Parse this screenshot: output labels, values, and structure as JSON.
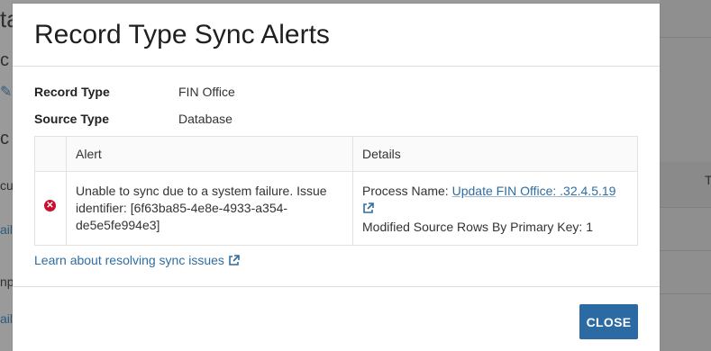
{
  "background": {
    "frag_1": "ta",
    "frag_2": "c S",
    "frag_3": "c I",
    "frag_4": "cu",
    "frag_5": "ail",
    "frag_6": "np",
    "frag_7": "ail",
    "frag_right": "T"
  },
  "modal": {
    "title": "Record Type Sync Alerts",
    "record_type_label": "Record Type",
    "record_type_value": "FIN Office",
    "source_type_label": "Source Type",
    "source_type_value": "Database",
    "table": {
      "headers": [
        "",
        "Alert",
        "Details"
      ],
      "rows": [
        {
          "status_icon": "error-circle-icon",
          "alert": "Unable to sync due to a system failure. Issue identifier: [6f63ba85-4e8e-4933-a354-de5e5fe994e3]",
          "process_name_label": "Process Name: ",
          "process_name_link": "Update FIN Office: .32.4.5.19",
          "modified_rows": "Modified Source Rows By Primary Key: 1"
        }
      ]
    },
    "learn_link": "Learn about resolving sync issues",
    "close_label": "CLOSE"
  },
  "colors": {
    "primary_button": "#2b6aa3",
    "link": "#2f6da0",
    "error": "#c8102e",
    "overlay": "#9a9a9a"
  }
}
